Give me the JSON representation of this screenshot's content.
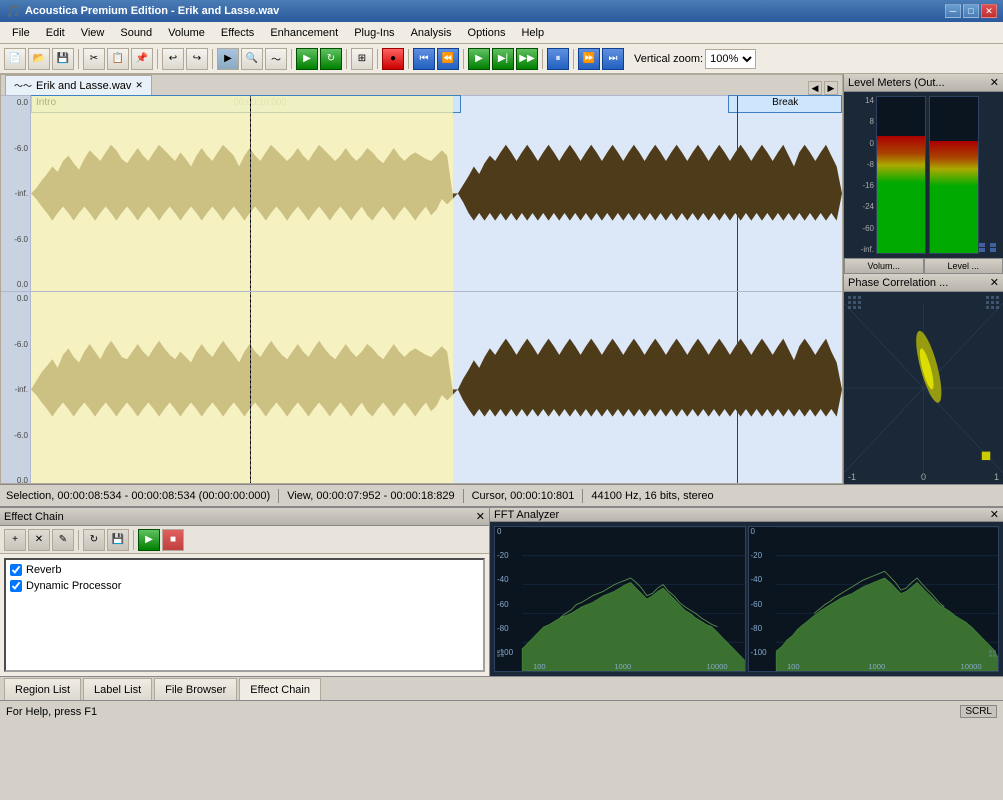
{
  "app": {
    "title": "Acoustica Premium Edition - Erik and Lasse.wav",
    "icon": "♪"
  },
  "titlebar": {
    "minimize": "─",
    "maximize": "□",
    "close": "✕"
  },
  "menu": {
    "items": [
      "File",
      "Edit",
      "View",
      "Sound",
      "Volume",
      "Effects",
      "Enhancement",
      "Plug-Ins",
      "Analysis",
      "Options",
      "Help"
    ]
  },
  "toolbar": {
    "zoom_label": "Vertical zoom:",
    "zoom_value": "100%"
  },
  "tabs": {
    "main_tab": "Erik and Lasse.wav"
  },
  "ruler": {
    "marker": "00:00:10:000"
  },
  "regions": {
    "intro": "Intro",
    "break": "Break"
  },
  "track1": {
    "scales": [
      "0.0",
      "-6.0",
      "-inf.",
      "-6.0",
      "0.0"
    ]
  },
  "track2": {
    "scales": [
      "0.0",
      "-6.0",
      "-inf.",
      "-6.0",
      "0.0"
    ]
  },
  "statusbar": {
    "selection": "Selection, 00:00:08:534 - 00:00:08:534 (00:00:00:000)",
    "view": "View, 00:00:07:952 - 00:00:18:829",
    "cursor": "Cursor, 00:00:10:801",
    "format": "44100 Hz, 16 bits, stereo"
  },
  "level_meters": {
    "title": "Level Meters (Out...",
    "scales": [
      "14",
      "8",
      "0",
      "-8",
      "-16",
      "-24",
      "-60",
      "-inf."
    ],
    "tab1": "Volum...",
    "tab2": "Level ..."
  },
  "phase_correlation": {
    "title": "Phase Correlation ...",
    "left_label": "-1",
    "center_label": "0",
    "right_label": "1"
  },
  "effect_chain": {
    "title": "Effect Chain",
    "effects": [
      {
        "name": "Reverb",
        "enabled": true
      },
      {
        "name": "Dynamic Processor",
        "enabled": true
      }
    ]
  },
  "fft_analyzer": {
    "title": "FFT Analyzer",
    "left_graph": {
      "y_labels": [
        "0",
        "-20",
        "-40",
        "-60",
        "-80",
        "-100"
      ],
      "x_labels": [
        "100",
        "1000",
        "10000"
      ]
    },
    "right_graph": {
      "y_labels": [
        "0",
        "-20",
        "-40",
        "-60",
        "-80",
        "-100"
      ],
      "x_labels": [
        "100",
        "1000",
        "10000"
      ]
    }
  },
  "bottom_tabs": [
    "Region List",
    "Label List",
    "File Browser",
    "Effect Chain"
  ],
  "final_status": {
    "help": "For Help, press F1",
    "scrl": "SCRL"
  }
}
